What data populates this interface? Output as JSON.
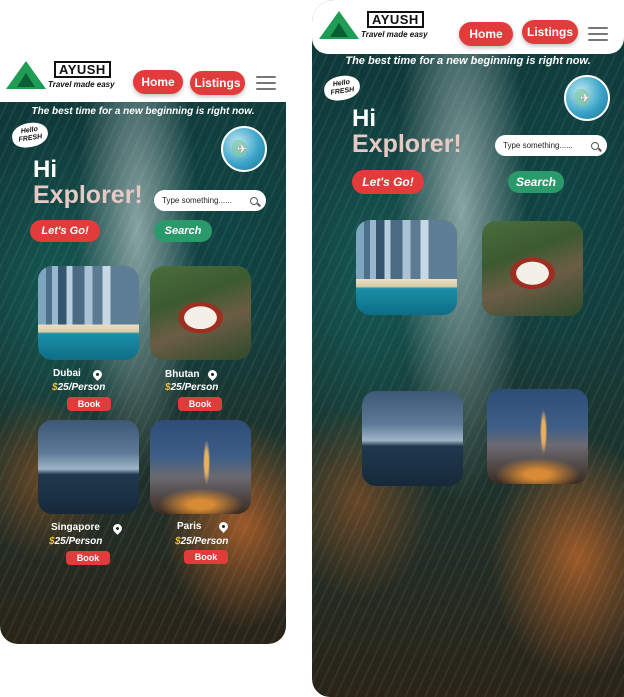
{
  "brand": {
    "name": "AYUSH",
    "tagline": "Travel made easy"
  },
  "nav": {
    "home": "Home",
    "listings": "Listings"
  },
  "hero": {
    "headline": "The best time for a new beginning is right now.",
    "badge": "Hello FRESH",
    "greeting": "Hi",
    "title": "Explorer!",
    "cta": "Let's Go!"
  },
  "search": {
    "placeholder": "Type something......",
    "button": "Search"
  },
  "destinations": [
    {
      "name": "Dubai",
      "price": "25",
      "unit": "/Person",
      "currency": "$",
      "action": "Book"
    },
    {
      "name": "Bhutan",
      "price": "25",
      "unit": "/Person",
      "currency": "$",
      "action": "Book"
    },
    {
      "name": "Singapore",
      "price": "25",
      "unit": "/Person",
      "currency": "$",
      "action": "Book"
    },
    {
      "name": "Paris",
      "price": "25",
      "unit": "/Person",
      "currency": "$",
      "action": "Book"
    }
  ],
  "colors": {
    "accent": "#e23b3b",
    "search": "#2a9a6a",
    "explorer": "#e7c9c5",
    "logo": "#1f9d55"
  }
}
